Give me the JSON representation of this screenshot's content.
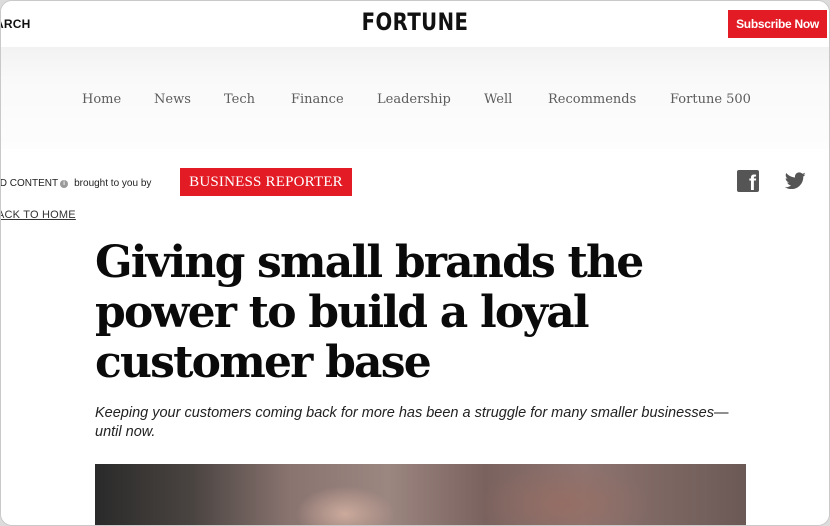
{
  "header": {
    "search_label": "ARCH",
    "logo": "FORTUNE",
    "subscribe_label": "Subscribe Now"
  },
  "nav": {
    "items": [
      "Home",
      "News",
      "Tech",
      "Finance",
      "Leadership",
      "Well",
      "Recommends",
      "Fortune 500"
    ]
  },
  "sponsor": {
    "paid_label": "ID CONTENT",
    "brought_by": "brought to you by",
    "name": "BUSINESS REPORTER",
    "back_link": "ACK TO HOME"
  },
  "social": {
    "icons": [
      "facebook-icon",
      "twitter-icon"
    ],
    "color": "#555555"
  },
  "article": {
    "headline": "Giving small brands the power to build a loyal customer base",
    "subhead": "Keeping your customers coming back for more has been a struggle for many smaller businesses—until now."
  },
  "colors": {
    "accent": "#e21b24",
    "nav_text": "#5c5c5c"
  }
}
